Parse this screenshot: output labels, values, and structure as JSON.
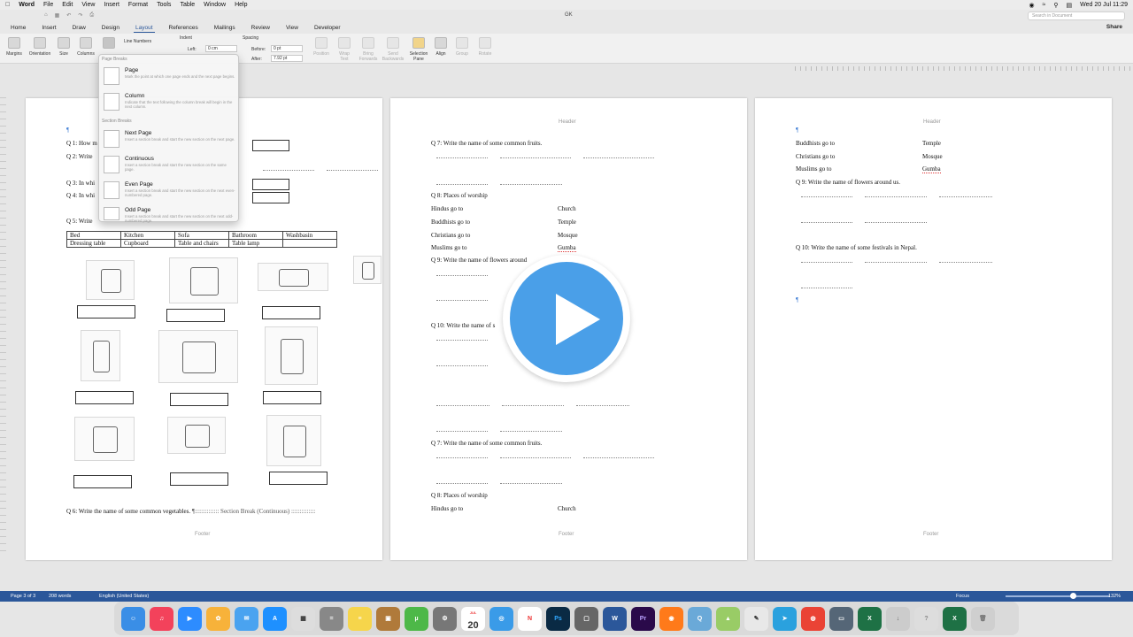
{
  "menubar": {
    "app": "Word",
    "items": [
      "File",
      "Edit",
      "View",
      "Insert",
      "Format",
      "Tools",
      "Table",
      "Window",
      "Help"
    ],
    "clock": "Wed 20 Jul  11:29"
  },
  "titlebar": {
    "doc_title": "GK",
    "search_placeholder": "Search in Document"
  },
  "tabs": [
    "Home",
    "Insert",
    "Draw",
    "Design",
    "Layout",
    "References",
    "Mailings",
    "Review",
    "View",
    "Developer"
  ],
  "active_tab": "Layout",
  "share_label": "Share",
  "ribbon": {
    "margins": "Margins",
    "orientation": "Orientation",
    "size": "Size",
    "columns": "Columns",
    "line_numbers": "Line Numbers",
    "indent_label": "Indent",
    "left_label": "Left:",
    "left_value": "0 cm",
    "spacing_label": "Spacing",
    "before_label": "Before:",
    "before_value": "0 pt",
    "after_label": "After:",
    "after_value": "7.92 pt",
    "position": "Position",
    "wrap_text": "Wrap Text",
    "bring_forwards": "Bring Forwards",
    "send_backwards": "Send Backwards",
    "selection_pane": "Selection Pane",
    "align": "Align",
    "group": "Group",
    "rotate": "Rotate"
  },
  "breaks_menu": {
    "page_breaks_header": "Page Breaks",
    "section_breaks_header": "Section Breaks",
    "options": [
      {
        "title": "Page",
        "desc": "Mark the point at which one page ends and the next page begins."
      },
      {
        "title": "Column",
        "desc": "Indicate that the text following the column break will begin in the next column."
      },
      {
        "title": "Next Page",
        "desc": "Insert a section break and start the new section on the next page."
      },
      {
        "title": "Continuous",
        "desc": "Insert a section break and start the new section on the same page."
      },
      {
        "title": "Even Page",
        "desc": "Insert a section break and start the new section on the next even-numbered page."
      },
      {
        "title": "Odd Page",
        "desc": "Insert a section break and start the new section on the next odd-numbered page."
      }
    ]
  },
  "page1": {
    "q1": "Q 1: How m",
    "q2": "Q 2: Write",
    "q3": "Q 3: In whi",
    "q4": "Q 4: In whi",
    "q5": "Q 5: Write",
    "table": [
      [
        "Bed",
        "Kitchen",
        "Sofa",
        "Bathroom",
        "Washbasin"
      ],
      [
        "Dressing table",
        "Cupboard",
        "Table and chairs",
        "Table lamp",
        ""
      ]
    ],
    "q6": "Q 6: Write the name of some common vegetables.",
    "section_break": "Section Break (Continuous)",
    "footer": "Footer"
  },
  "page2": {
    "header": "Header",
    "q7": "Q 7: Write the name of some common fruits.",
    "q8": "Q 8: Places of worship",
    "worship": [
      [
        "Hindus go to",
        "Church"
      ],
      [
        "Buddhists go to",
        "Temple"
      ],
      [
        "Christians go to",
        "Mosque"
      ],
      [
        "Muslims go to",
        "Gumba"
      ]
    ],
    "q9": "Q 9: Write the name of flowers around",
    "q10": "Q 10: Write the name of s",
    "q7b": "Q 7: Write the name of some common fruits.",
    "q8b": "Q 8: Places of worship",
    "hindus": "Hindus go to",
    "church": "Church",
    "footer": "Footer"
  },
  "page3": {
    "header": "Header",
    "worship": [
      [
        "Buddhists go to",
        "Temple"
      ],
      [
        "Christians go to",
        "Mosque"
      ],
      [
        "Muslims go to",
        "Gumba"
      ]
    ],
    "q9": "Q 9: Write the name of flowers around us.",
    "q10": "Q 10: Write the name of some festivals in Nepal.",
    "footer": "Footer"
  },
  "status": {
    "page": "Page 3 of 3",
    "words": "208 words",
    "language": "English (United States)",
    "focus": "Focus",
    "zoom": "132%"
  },
  "dock_date": "20",
  "dock_month": "JUL"
}
